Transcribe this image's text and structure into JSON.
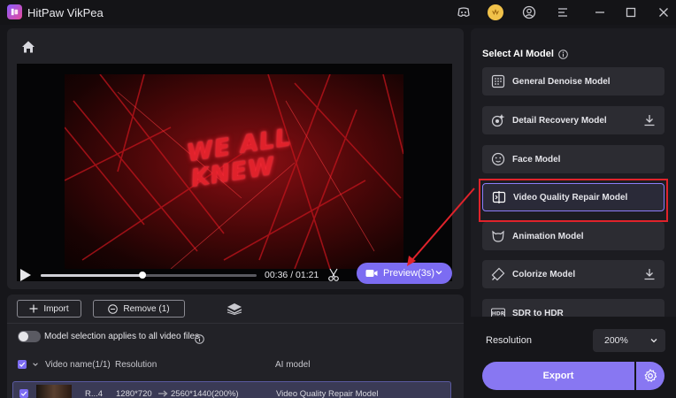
{
  "window": {
    "title": "HitPaw VikPea"
  },
  "player": {
    "frame_text": [
      "WE ALL",
      "KNEW"
    ],
    "progress_fraction": 0.47,
    "time": "00:36 / 01:21",
    "preview_label": "Preview(3s)"
  },
  "filelist": {
    "import_label": "Import",
    "remove_label": "Remove (1)",
    "toggle_label": "Model selection applies to all video files",
    "columns": [
      "Video name(1/1)",
      "Resolution",
      "AI model"
    ],
    "row": {
      "name": "R...4",
      "resolution_from": "1280*720",
      "resolution_to": "2560*1440(200%)",
      "model": "Video Quality Repair Model"
    }
  },
  "models": {
    "title": "Select AI Model",
    "items": [
      {
        "label": "General Denoise Model",
        "icon": "denoise-icon",
        "download": false
      },
      {
        "label": "Detail Recovery Model",
        "icon": "detail-icon",
        "download": true
      },
      {
        "label": "Face Model",
        "icon": "face-icon",
        "download": false
      },
      {
        "label": "Video Quality Repair Model",
        "icon": "repair-icon",
        "download": false,
        "selected": true
      },
      {
        "label": "Animation Model",
        "icon": "animation-icon",
        "download": false
      },
      {
        "label": "Colorize Model",
        "icon": "colorize-icon",
        "download": true
      },
      {
        "label": "SDR to HDR",
        "icon": "hdr-icon",
        "download": false
      }
    ]
  },
  "output": {
    "resolution_label": "Resolution",
    "resolution_value": "200%",
    "export_label": "Export"
  },
  "colors": {
    "accent": "#7c6cf2",
    "highlight": "#e0232b"
  }
}
